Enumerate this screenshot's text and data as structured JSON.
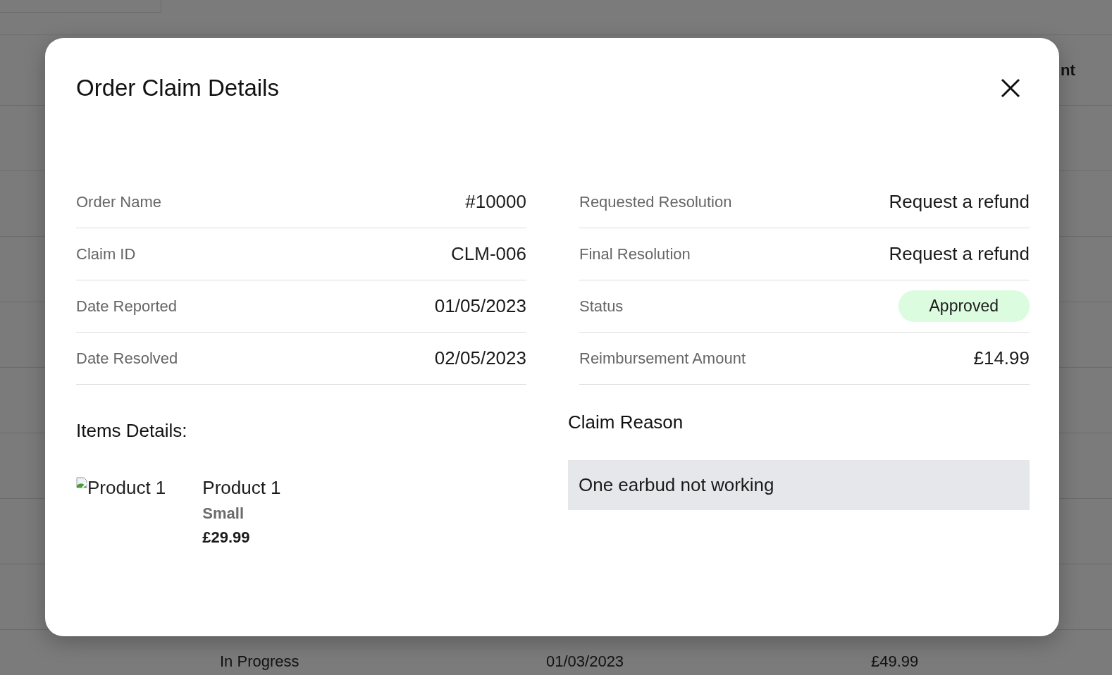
{
  "background": {
    "header_cells": [
      "nt"
    ],
    "visible_row": {
      "cells": [
        "In Progress",
        "01/03/2023",
        "£49.99"
      ]
    }
  },
  "modal": {
    "title": "Order Claim Details",
    "left_fields": [
      {
        "label": "Order Name",
        "value": "#10000"
      },
      {
        "label": "Claim ID",
        "value": "CLM-006"
      },
      {
        "label": "Date Reported",
        "value": "01/05/2023"
      },
      {
        "label": "Date Resolved",
        "value": "02/05/2023"
      }
    ],
    "right_fields": [
      {
        "kind": "text",
        "label": "Requested Resolution",
        "value": "Request a refund"
      },
      {
        "kind": "text",
        "label": "Final Resolution",
        "value": "Request a refund"
      },
      {
        "kind": "badge",
        "label": "Status",
        "value": "Approved",
        "color": "#dcfce0"
      },
      {
        "kind": "text",
        "label": "Reimbursement Amount",
        "value": "£14.99"
      }
    ],
    "items_heading": "Items Details:",
    "items": [
      {
        "image_alt": "Product 1",
        "name": "Product 1",
        "variant": "Small",
        "price": "£29.99"
      }
    ],
    "claim_reason": {
      "heading": "Claim Reason",
      "text": "One earbud not working"
    }
  }
}
